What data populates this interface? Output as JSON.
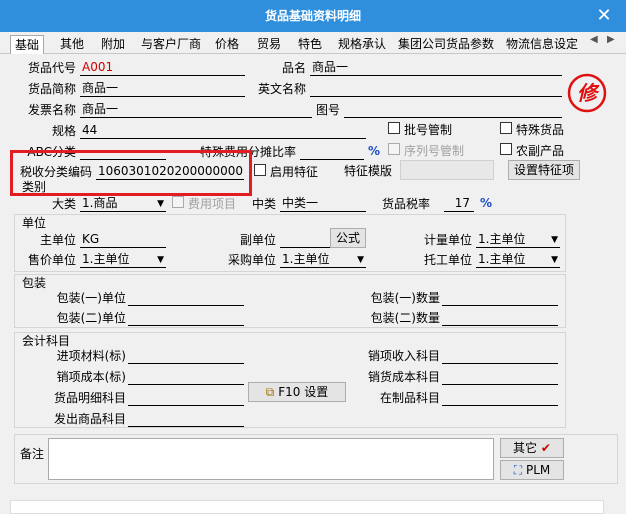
{
  "window": {
    "title": "货品基础资料明细"
  },
  "tabs": [
    "基础",
    "其他",
    "附加",
    "与客户厂商",
    "价格",
    "贸易",
    "特色",
    "规格承认",
    "集团公司货品参数",
    "物流信息设定"
  ],
  "fields": {
    "code_label": "货品代号",
    "code_value": "A001",
    "name_label": "品名",
    "name_value": "商品一",
    "short_label": "货品简称",
    "short_value": "商品一",
    "en_label": "英文名称",
    "en_value": "",
    "invoice_label": "发票名称",
    "invoice_value": "商品一",
    "image_label": "图号",
    "image_value": "",
    "spec_label": "规格",
    "spec_value": "44",
    "abc_label": "ABC分类",
    "abc_value": "",
    "special_fee_label": "特殊费用分摊比率",
    "special_fee_value": "",
    "tax_code_label": "税收分类编码",
    "tax_code_value": "1060301020200000000",
    "category_label": "类别",
    "feature_template_label": "特征模版",
    "big_cat_label": "大类",
    "big_cat_value": "1.商品",
    "mid_cat_label": "中类",
    "mid_cat_value": "中类一",
    "tax_rate_label": "货品税率",
    "tax_rate_value": "17",
    "percent_sign": "%"
  },
  "checkboxes": {
    "batch": "批号管制",
    "special_goods": "特殊货品",
    "serial": "序列号管制",
    "agri": "农副产品",
    "enable_feature": "启用特征",
    "fee_item": "费用项目"
  },
  "buttons": {
    "set_feature": "设置特征项",
    "formula": "公式",
    "f10": "F10 设置",
    "other": "其它",
    "plm": "PLM"
  },
  "unit": {
    "section": "单位",
    "main_label": "主单位",
    "main_value": "KG",
    "sub_label": "副单位",
    "sub_value": "",
    "calc_label": "计量单位",
    "calc_value": "1.主单位",
    "sale_label": "售价单位",
    "sale_value": "1.主单位",
    "purchase_label": "采购单位",
    "purchase_value": "1.主单位",
    "consign_label": "托工单位",
    "consign_value": "1.主单位"
  },
  "package": {
    "section": "包装",
    "p1_unit": "包装(一)单位",
    "p1_qty": "包装(一)数量",
    "p2_unit": "包装(二)单位",
    "p2_qty": "包装(二)数量"
  },
  "accounting": {
    "section": "会计科目",
    "purchase_material": "进项材料(标)",
    "sales_income": "销项收入科目",
    "sales_cost": "销项成本(标)",
    "sales_goods_cost": "销货成本科目",
    "goods_detail": "货品明细科目",
    "wip": "在制品科目",
    "shipped_goods": "发出商品科目"
  },
  "memo": {
    "label": "备注",
    "value": ""
  },
  "stamp": {
    "text": "修"
  },
  "colors": {
    "title_bar": "#2f8fdc",
    "highlight": "#e31b23",
    "stamp": "#e01010"
  }
}
